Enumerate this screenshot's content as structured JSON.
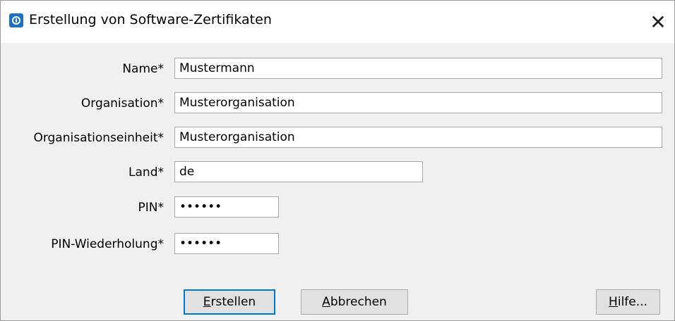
{
  "window": {
    "title": "Erstellung von Software-Zertifikaten",
    "close_glyph": "✕"
  },
  "form": {
    "fields": [
      {
        "label": "Name*",
        "value": "Mustermann"
      },
      {
        "label": "Organisation*",
        "value": "Musterorganisation"
      },
      {
        "label": "Organisationseinheit*",
        "value": "Musterorganisation"
      },
      {
        "label": "Land*",
        "value": "de"
      },
      {
        "label": "PIN*",
        "value": "••••••"
      },
      {
        "label": "PIN-Wiederholung*",
        "value": "••••••"
      }
    ]
  },
  "buttons": {
    "create": {
      "mnemonic": "E",
      "rest": "rstellen"
    },
    "cancel": {
      "mnemonic": "A",
      "rest": "bbrechen"
    },
    "help": {
      "mnemonic": "H",
      "rest": "ilfe..."
    }
  },
  "icons": {
    "app": "certificate-app-icon",
    "close": "close-icon"
  },
  "colors": {
    "accent": "#0078d7",
    "dialog_bg": "#f0f0f0",
    "titlebar_bg": "#ffffff"
  }
}
